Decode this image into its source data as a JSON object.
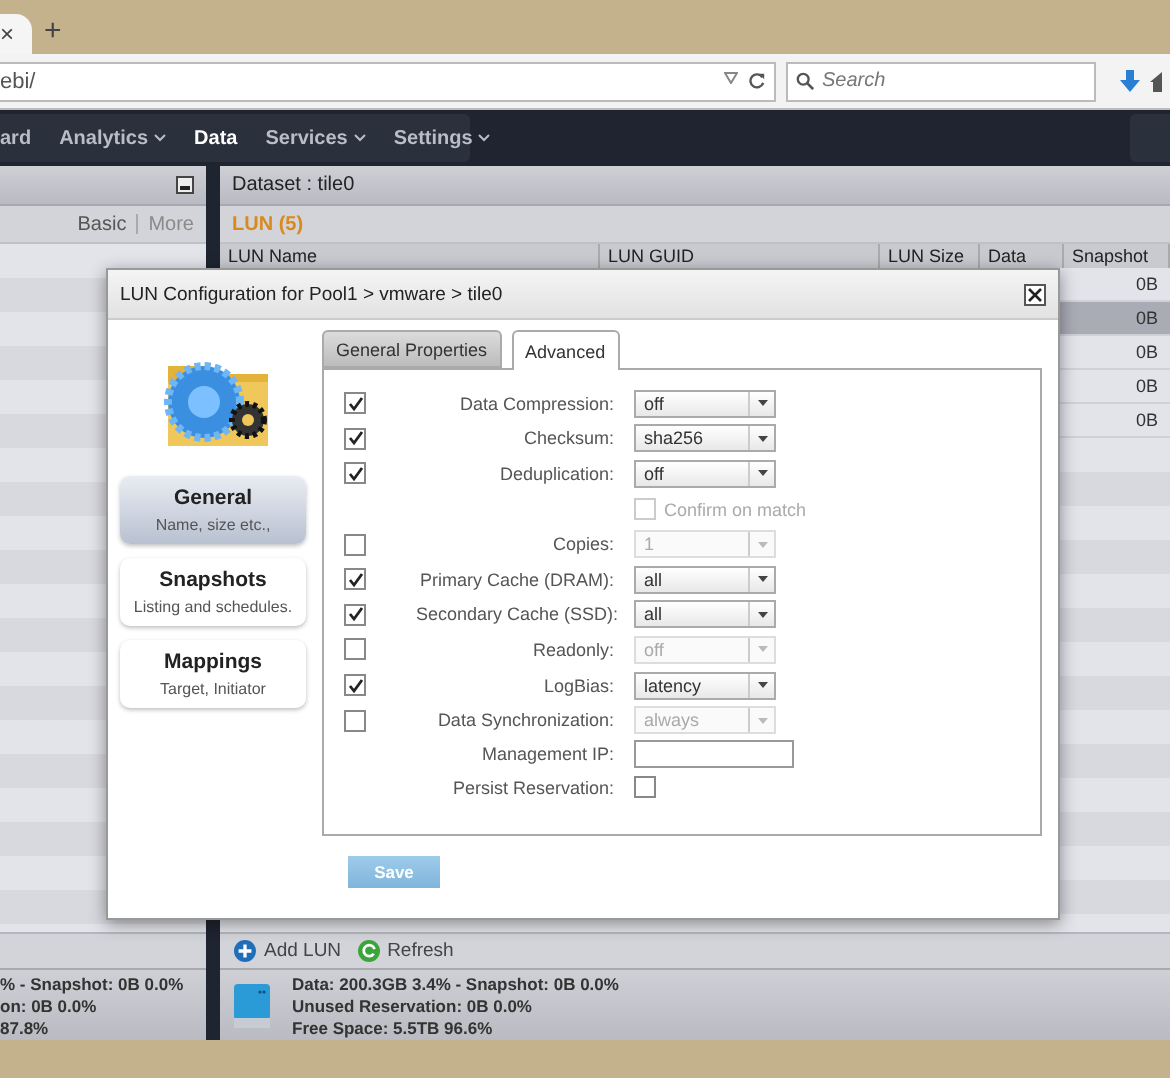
{
  "browser": {
    "tab_close": "×",
    "new_tab": "+",
    "url": "ebi/",
    "search_placeholder": "Search"
  },
  "nav": [
    {
      "label": "ard",
      "dropdown": false,
      "selected": false
    },
    {
      "label": "Analytics",
      "dropdown": true,
      "selected": false
    },
    {
      "label": "Data",
      "dropdown": false,
      "selected": true
    },
    {
      "label": "Services",
      "dropdown": true,
      "selected": false
    },
    {
      "label": "Settings",
      "dropdown": true,
      "selected": false
    }
  ],
  "left_panel": {
    "modes": [
      {
        "label": "Basic",
        "selected": true
      },
      {
        "label": "More",
        "selected": false
      }
    ],
    "stats": [
      "% - Snapshot: 0B 0.0%",
      "on: 0B 0.0%",
      "87.8%"
    ]
  },
  "dataset_panel": {
    "title": "Dataset : tile0",
    "lun_heading": "LUN (5)",
    "columns": [
      "LUN Name",
      "LUN GUID",
      "LUN Size",
      "Data",
      "Snapshot"
    ],
    "rows": [
      {
        "snapshot": "0B",
        "selected": false
      },
      {
        "snapshot": "0B",
        "selected": true
      },
      {
        "snapshot": "0B",
        "selected": false
      },
      {
        "snapshot": "0B",
        "selected": false
      },
      {
        "snapshot": "0B",
        "selected": false
      }
    ],
    "actions": [
      {
        "kind": "add",
        "label": "Add LUN"
      },
      {
        "kind": "refresh",
        "label": "Refresh"
      }
    ],
    "stats": [
      "Data: 200.3GB 3.4% - Snapshot: 0B 0.0%",
      "Unused Reservation: 0B 0.0%",
      "Free Space: 5.5TB 96.6%"
    ]
  },
  "dialog": {
    "title": "LUN Configuration for Pool1 > vmware > tile0",
    "nav": [
      {
        "title": "General",
        "subtitle": "Name, size etc.,",
        "selected": true
      },
      {
        "title": "Snapshots",
        "subtitle": "Listing and schedules.",
        "selected": false
      },
      {
        "title": "Mappings",
        "subtitle": "Target, Initiator",
        "selected": false
      }
    ],
    "tabs": [
      {
        "label": "General Properties",
        "selected": false
      },
      {
        "label": "Advanced",
        "selected": true
      }
    ],
    "fields": [
      {
        "kind": "select",
        "checked": true,
        "label": "Data Compression:",
        "value": "off",
        "disabled": false
      },
      {
        "kind": "select",
        "checked": true,
        "label": "Checksum:",
        "value": "sha256",
        "disabled": false
      },
      {
        "kind": "select",
        "checked": true,
        "label": "Deduplication:",
        "value": "off",
        "disabled": false
      },
      {
        "kind": "confirm",
        "label": "Confirm on match",
        "checked": false,
        "disabled": true
      },
      {
        "kind": "select",
        "checked": false,
        "label": "Copies:",
        "value": "1",
        "disabled": true
      },
      {
        "kind": "select",
        "checked": true,
        "label": "Primary Cache (DRAM):",
        "value": "all",
        "disabled": false
      },
      {
        "kind": "select",
        "checked": true,
        "label": "Secondary Cache (SSD):",
        "value": "all",
        "disabled": false
      },
      {
        "kind": "select",
        "checked": false,
        "label": "Readonly:",
        "value": "off",
        "disabled": true
      },
      {
        "kind": "select",
        "checked": true,
        "label": "LogBias:",
        "value": "latency",
        "disabled": false
      },
      {
        "kind": "select",
        "checked": false,
        "label": "Data Synchronization:",
        "value": "always",
        "disabled": true
      },
      {
        "kind": "text",
        "label": "Management IP:"
      },
      {
        "kind": "checkbox",
        "label": "Persist Reservation:",
        "checked": false
      }
    ],
    "save": "Save"
  }
}
